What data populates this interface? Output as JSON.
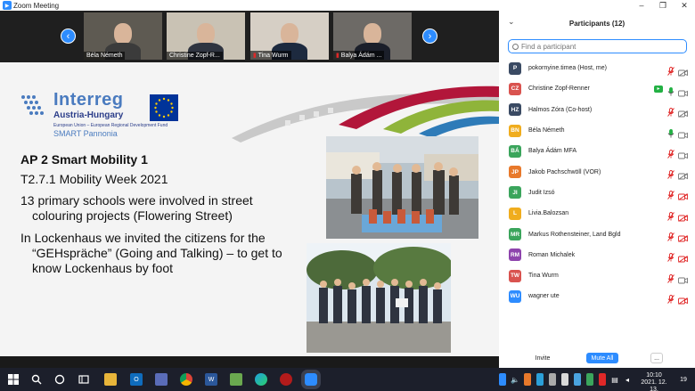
{
  "window": {
    "title": "Zoom Meeting",
    "minimize": "–",
    "maximize": "❐",
    "close": "✕"
  },
  "video_strip": {
    "prev_arrow": "‹",
    "next_arrow": "›",
    "tiles": [
      {
        "name": "Béla Németh",
        "muted": false,
        "bg": "#5e5a52",
        "shirt": "#3b3b3b"
      },
      {
        "name": "Christine Zopf-R...",
        "muted": false,
        "bg": "#c9c2b4",
        "shirt": "#2f3440",
        "active": true
      },
      {
        "name": "Tina Wurm",
        "muted": true,
        "bg": "#d6cfc5",
        "shirt": "#1d2a3f"
      },
      {
        "name": "Balya Ádám ...",
        "muted": true,
        "bg": "#6d6a66",
        "shirt": "#1b1f2a"
      }
    ]
  },
  "slide": {
    "logo": {
      "word": "Interreg",
      "program": "Austria-Hungary",
      "eu_line": "European Union – European Regional Development Fund",
      "project": "SMART Pannonia"
    },
    "title": "AP 2 Smart Mobility 1",
    "line1": "T2.7.1 Mobility Week 2021",
    "line2a": "13 primary schools were involved in street",
    "line2b": "colouring projects (Flowering Street)",
    "line3a": "In Lockenhaus we invited the citizens for the",
    "line3b": "“GEHspräche” (Going and Talking) – to get to",
    "line3c": "know Lockenhaus by foot"
  },
  "participants": {
    "header": "Participants (12)",
    "search_placeholder": "Find a participant",
    "list": [
      {
        "initials": "P",
        "name": "pokornyine.timea (Host, me)",
        "color": "#3a4a63",
        "mic": "muted",
        "video": "off"
      },
      {
        "initials": "CZ",
        "name": "Christine Zopf-Renner",
        "color": "#d9534f",
        "mic": "on",
        "video": "on",
        "sharing": true
      },
      {
        "initials": "HZ",
        "name": "Halmos Zóra (Co-host)",
        "color": "#3a4a63",
        "mic": "muted",
        "video": "off"
      },
      {
        "initials": "BN",
        "name": "Béla Németh",
        "color": "#f0ad1e",
        "mic": "on",
        "video": "on"
      },
      {
        "initials": "BÁ",
        "name": "Balya Ádám MFA",
        "color": "#3ba55c",
        "mic": "muted",
        "video": "on"
      },
      {
        "initials": "JP",
        "name": "Jakob Pachschwöll (VOR)",
        "color": "#e8792b",
        "mic": "muted",
        "video": "off"
      },
      {
        "initials": "JI",
        "name": "Judit Izsó",
        "color": "#3ba55c",
        "mic": "muted",
        "video": "off-red"
      },
      {
        "initials": "L",
        "name": "Livia.Balozsan",
        "color": "#f0ad1e",
        "mic": "muted",
        "video": "off-red"
      },
      {
        "initials": "MR",
        "name": "Markus Rothensteiner, Land Bgld",
        "color": "#3ba55c",
        "mic": "muted",
        "video": "off-red"
      },
      {
        "initials": "RM",
        "name": "Roman Michalek",
        "color": "#8e44ad",
        "mic": "muted",
        "video": "off-red"
      },
      {
        "initials": "TW",
        "name": "Tina Wurm",
        "color": "#d9534f",
        "mic": "muted",
        "video": "on"
      },
      {
        "initials": "WU",
        "name": "wagner ute",
        "color": "#2d8cff",
        "mic": "muted",
        "video": "off-red"
      }
    ],
    "footer": {
      "invite": "Invite",
      "mute_all": "Mute All",
      "more": "..."
    }
  },
  "taskbar": {
    "time": "10:10",
    "date": "2021. 12. 13.",
    "notifications": "19"
  },
  "colors": {
    "zoom_blue": "#2d8cff",
    "muted_red": "#e02828",
    "taskbar": "#1c1f2b"
  }
}
